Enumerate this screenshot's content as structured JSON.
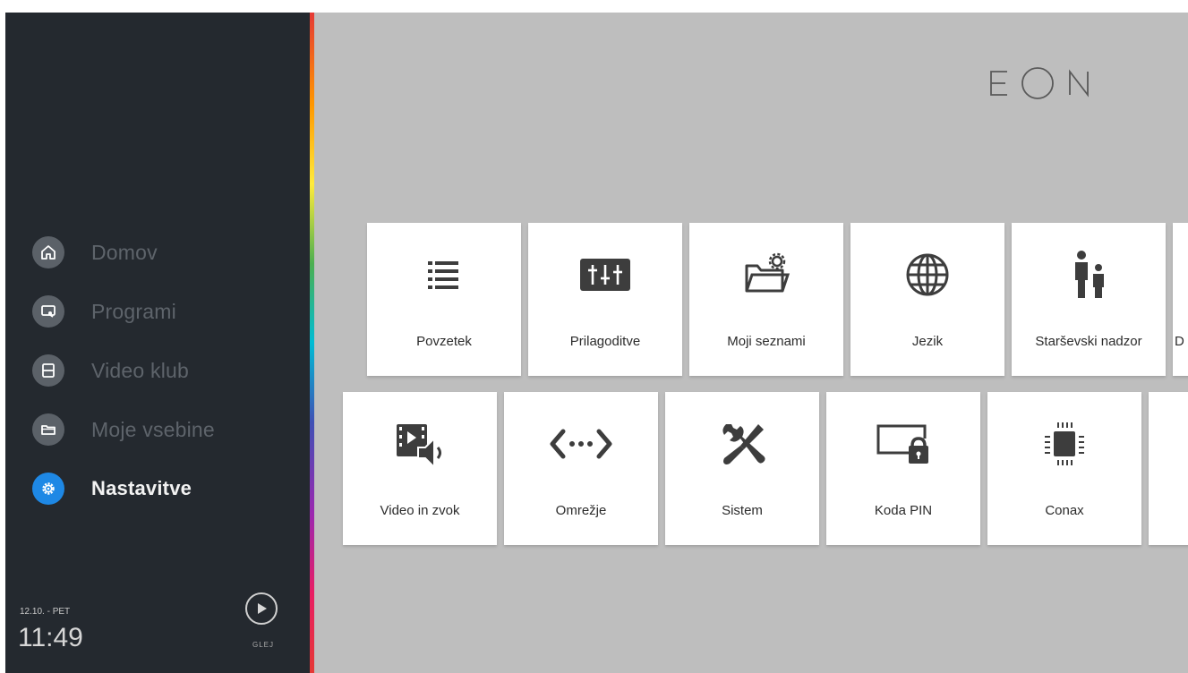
{
  "sidebar": {
    "items": [
      {
        "label": "Domov",
        "icon": "home-icon"
      },
      {
        "label": "Programi",
        "icon": "tv-icon"
      },
      {
        "label": "Video klub",
        "icon": "film-icon"
      },
      {
        "label": "Moje vsebine",
        "icon": "folder-icon"
      },
      {
        "label": "Nastavitve",
        "icon": "gear-icon",
        "active": true
      }
    ],
    "date": "12.10. - PET",
    "time": "11:49",
    "play_label": "GLEJ"
  },
  "colors": {
    "accent": "#1e88e5",
    "sidebar_bg": "#24292f",
    "main_bg": "#bebebe"
  },
  "tiles_row1": [
    {
      "label": "Povzetek",
      "icon": "list-icon"
    },
    {
      "label": "Prilagoditve",
      "icon": "equalizer-icon"
    },
    {
      "label": "Moji seznami",
      "icon": "folder-settings-icon"
    },
    {
      "label": "Jezik",
      "icon": "globe-icon"
    },
    {
      "label": "Starševski nadzor",
      "icon": "parent-child-icon"
    },
    {
      "label": "D",
      "icon": ""
    }
  ],
  "tiles_row2": [
    {
      "label": "Video in zvok",
      "icon": "video-sound-icon"
    },
    {
      "label": "Omrežje",
      "icon": "network-icon"
    },
    {
      "label": "Sistem",
      "icon": "tools-icon"
    },
    {
      "label": "Koda PIN",
      "icon": "screen-lock-icon"
    },
    {
      "label": "Conax",
      "icon": "chip-icon"
    },
    {
      "label": "",
      "icon": ""
    }
  ]
}
